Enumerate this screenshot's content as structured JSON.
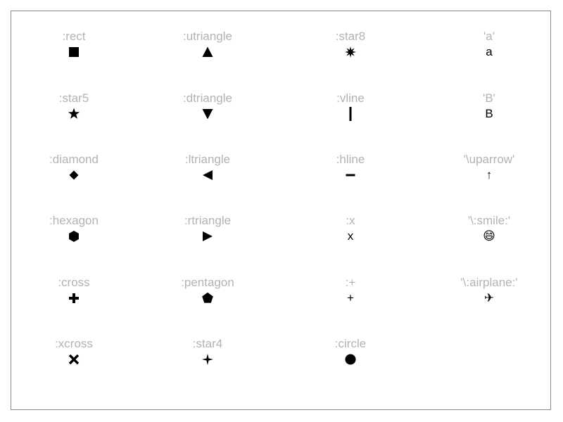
{
  "markers": [
    {
      "label": ":rect",
      "kind": "rect"
    },
    {
      "label": ":star5",
      "kind": "star5"
    },
    {
      "label": ":diamond",
      "kind": "diamond"
    },
    {
      "label": ":hexagon",
      "kind": "hexagon"
    },
    {
      "label": ":cross",
      "kind": "cross"
    },
    {
      "label": ":xcross",
      "kind": "xcross"
    },
    {
      "label": ":utriangle",
      "kind": "utriangle"
    },
    {
      "label": ":dtriangle",
      "kind": "dtriangle"
    },
    {
      "label": ":ltriangle",
      "kind": "ltriangle"
    },
    {
      "label": ":rtriangle",
      "kind": "rtriangle"
    },
    {
      "label": ":pentagon",
      "kind": "pentagon"
    },
    {
      "label": ":star4",
      "kind": "star4"
    },
    {
      "label": ":star8",
      "kind": "star8"
    },
    {
      "label": ":vline",
      "kind": "vline"
    },
    {
      "label": ":hline",
      "kind": "hline"
    },
    {
      "label": ":x",
      "kind": "text",
      "glyph": "x"
    },
    {
      "label": ":+",
      "kind": "text",
      "glyph": "+"
    },
    {
      "label": ":circle",
      "kind": "circle"
    },
    {
      "label": "'a'",
      "kind": "text",
      "glyph": "a"
    },
    {
      "label": "'B'",
      "kind": "text",
      "glyph": "B"
    },
    {
      "label": "'\\uparrow'",
      "kind": "text",
      "glyph": "↑"
    },
    {
      "label": "'\\:smile:'",
      "kind": "text",
      "glyph": "😄"
    },
    {
      "label": "'\\:airplane:'",
      "kind": "text",
      "glyph": "✈"
    }
  ],
  "colors": {
    "label": "#b3b3b3",
    "marker": "#000000",
    "frame": "#8a8a8a"
  }
}
